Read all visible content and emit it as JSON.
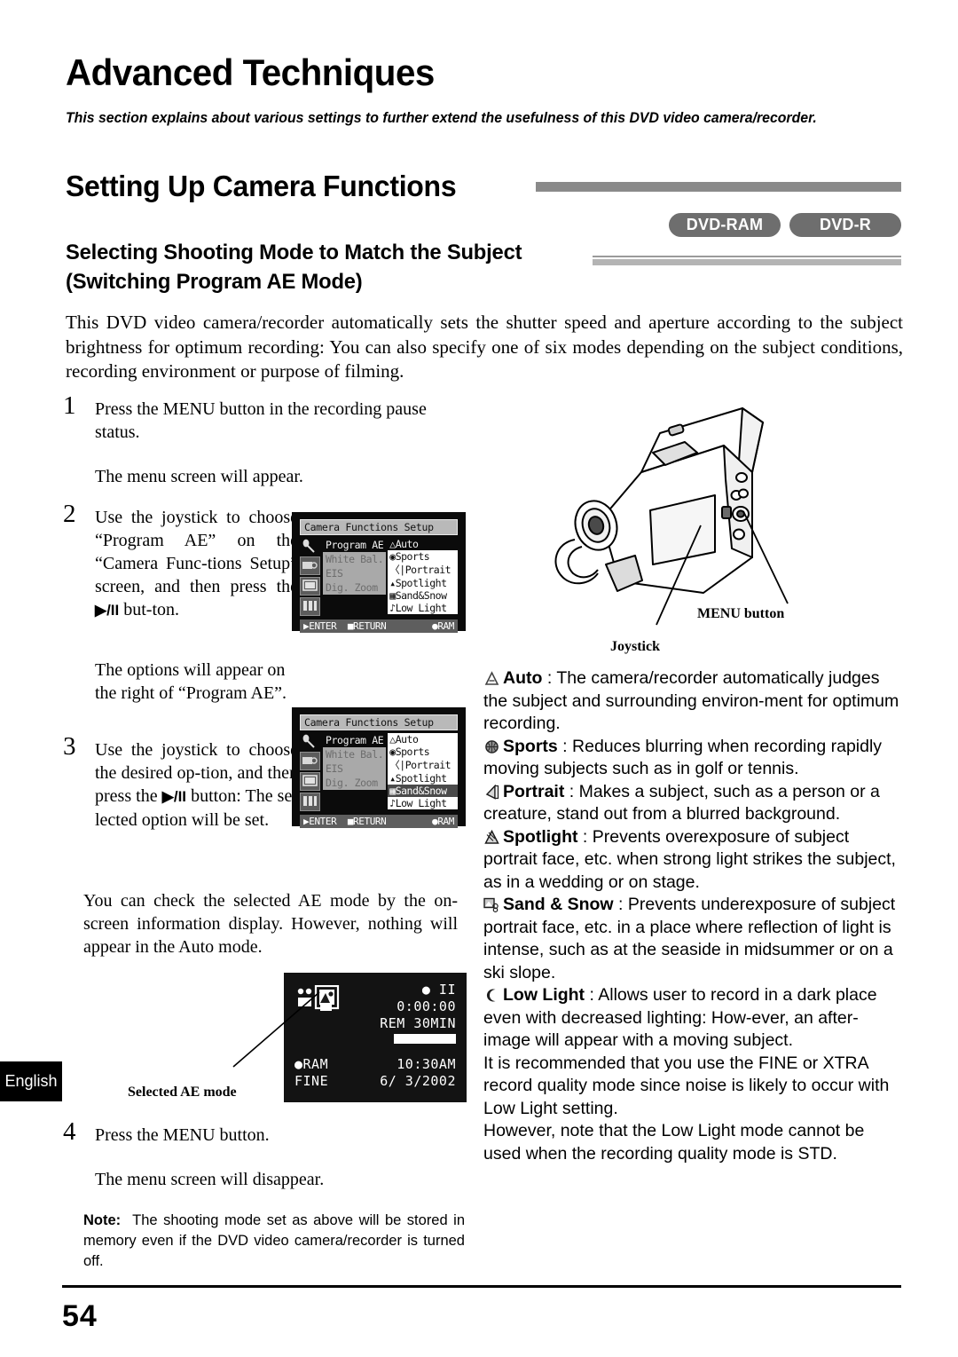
{
  "chapter_title": "Advanced Techniques",
  "chapter_intro": "This section explains about various settings to further extend the usefulness of this DVD video camera/recorder.",
  "section_title": "Setting Up Camera Functions",
  "subsection_title": "Selecting Shooting Mode to Match the Subject (Switching Program AE Mode)",
  "badges": [
    {
      "label": "DVD-RAM"
    },
    {
      "label": "DVD-R"
    }
  ],
  "intro_paragraph": "This DVD video camera/recorder automatically sets the shutter speed and aperture according to the subject brightness for optimum recording: You can also specify one of six modes depending on the subject conditions, recording environment or purpose of filming.",
  "steps": {
    "s1_num": "1",
    "s1_text": "Press the MENU button in the recording pause status.",
    "s1_result": "The menu screen will appear.",
    "s2_num": "2",
    "s2_text_a": "Use the joystick to choose “Program AE” on the “Camera Func-tions Setup” screen, and then press the ",
    "s2_glyph": "▶/II",
    "s2_text_b": " but-ton.",
    "s2_result": "The options will appear on the right of “Program AE”.",
    "s3_num": "3",
    "s3_text_a": "Use the joystick to choose the desired op-tion, and then press the ",
    "s3_glyph": "▶/II",
    "s3_text_b": " button: The se-lected option will be set.",
    "s4_num": "4",
    "s4_text": "Press the MENU button.",
    "s4_result": "The menu screen will disappear."
  },
  "check_paragraph": "You can check the selected AE mode by the on-screen information display. However, nothing will appear in the Auto mode.",
  "note": {
    "label": "Note:",
    "text": "The shooting mode set as above will be stored in memory even if the DVD video camera/recorder is turned off."
  },
  "camera_labels": {
    "menu_button": "MENU button",
    "joystick": "Joystick"
  },
  "osd_caption": "Selected AE mode",
  "menu_screen_1": {
    "title": "Camera Functions Setup",
    "rows": [
      {
        "label": "Program AE",
        "state": "active"
      },
      {
        "label": "White Bal.",
        "state": "dim"
      },
      {
        "label": "EIS",
        "state": "dim"
      },
      {
        "label": "Dig. Zoom",
        "state": "dim"
      }
    ],
    "options": [
      {
        "icon": "auto-icon",
        "label": "Auto",
        "selected": true
      },
      {
        "icon": "sports-icon",
        "label": "Sports",
        "selected": false
      },
      {
        "icon": "portrait-icon",
        "label": "Portrait",
        "selected": false
      },
      {
        "icon": "spotlight-icon",
        "label": "Spotlight",
        "selected": false
      },
      {
        "icon": "sandsnow-icon",
        "label": "Sand&Snow",
        "selected": false
      },
      {
        "icon": "lowlight-icon",
        "label": "Low Light",
        "selected": false
      }
    ],
    "footer_enter": "ENTER",
    "footer_return": "RETURN",
    "footer_disc": "RAM"
  },
  "menu_screen_2": {
    "title": "Camera Functions Setup",
    "rows": [
      {
        "label": "Program AE",
        "state": "active"
      },
      {
        "label": "White Bal.",
        "state": "dim"
      },
      {
        "label": "EIS",
        "state": "dim"
      },
      {
        "label": "Dig. Zoom",
        "state": "dim"
      }
    ],
    "options": [
      {
        "icon": "auto-icon",
        "label": "Auto",
        "selected": false
      },
      {
        "icon": "sports-icon",
        "label": "Sports",
        "selected": false
      },
      {
        "icon": "portrait-icon",
        "label": "Portrait",
        "selected": false
      },
      {
        "icon": "spotlight-icon",
        "label": "Spotlight",
        "selected": false
      },
      {
        "icon": "sandsnow-icon",
        "label": "Sand&Snow",
        "selected": true
      },
      {
        "icon": "lowlight-icon",
        "label": "Low Light",
        "selected": false
      }
    ],
    "footer_enter": "ENTER",
    "footer_return": "RETURN",
    "footer_disc": "RAM"
  },
  "osd_display": {
    "rec_status": "● II",
    "timecode": "0:00:00",
    "remaining": "REM 30MIN",
    "disc_type": "RAM",
    "quality": "FINE",
    "clock": "10:30AM",
    "date": "6/ 3/2002"
  },
  "modes": [
    {
      "icon": "auto-icon",
      "name": "Auto",
      "sep": " : ",
      "desc": "The camera/recorder automatically judges the subject and surrounding environ-ment for optimum recording."
    },
    {
      "icon": "sports-icon",
      "name": "Sports",
      "sep": " : ",
      "desc": "Reduces blurring when recording rapidly moving subjects such as in golf or tennis."
    },
    {
      "icon": "portrait-icon",
      "name": "Portrait",
      "sep": " : ",
      "desc": "Makes a subject, such as a person or a creature, stand out from a blurred background."
    },
    {
      "icon": "spotlight-icon",
      "name": "Spotlight",
      "sep": " : ",
      "desc": "Prevents overexposure of subject portrait face, etc. when strong light strikes the subject, as in a wedding or on stage."
    },
    {
      "icon": "sandsnow-icon",
      "name": "Sand & Snow",
      "sep": " : ",
      "desc": "Prevents underexposure of subject portrait face, etc. in a place where reflection of light is intense, such as at the seaside in midsummer or on a ski slope."
    },
    {
      "icon": "lowlight-icon",
      "name": "Low Light",
      "sep": " : ",
      "desc": "Allows user to record in a dark place even with decreased lighting: How-ever, an after-image will appear with a moving subject."
    }
  ],
  "mode_notes": [
    "It is recommended that you use the FINE or XTRA record quality mode since noise is likely to occur with Low Light setting.",
    "However, note that the Low Light mode cannot be used when the recording quality mode is STD."
  ],
  "language_tab": "English",
  "page_number": "54"
}
